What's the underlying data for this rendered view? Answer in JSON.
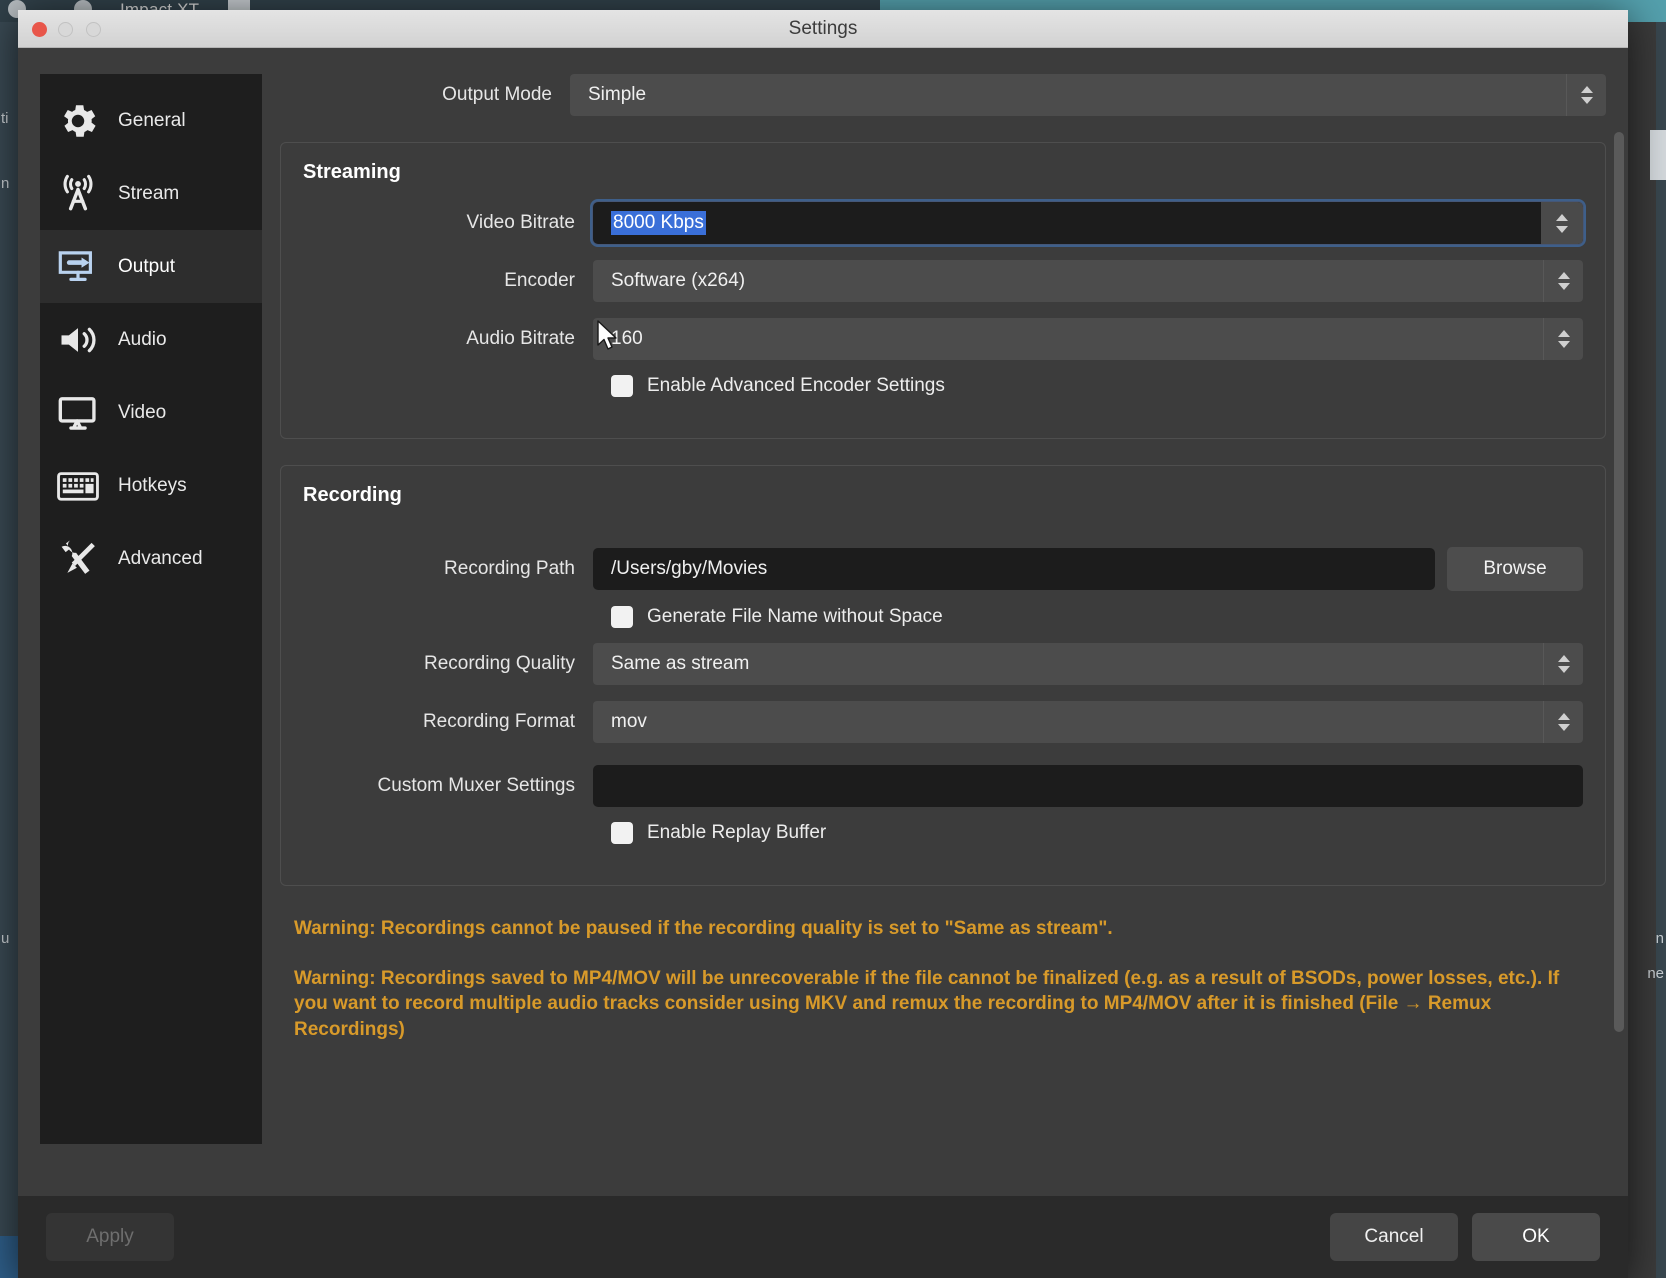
{
  "background_app": {
    "title": "Impact XT",
    "left_glyphs": [
      "ti",
      "n",
      "u"
    ],
    "right_glyphs": [
      "n",
      "ne"
    ]
  },
  "window": {
    "title": "Settings",
    "traffic_lights": [
      "close",
      "minimize",
      "maximize"
    ]
  },
  "sidebar": {
    "items": [
      {
        "label": "General",
        "icon": "gear-icon",
        "selected": false
      },
      {
        "label": "Stream",
        "icon": "broadcast-icon",
        "selected": false
      },
      {
        "label": "Output",
        "icon": "output-icon",
        "selected": true
      },
      {
        "label": "Audio",
        "icon": "speaker-icon",
        "selected": false
      },
      {
        "label": "Video",
        "icon": "monitor-icon",
        "selected": false
      },
      {
        "label": "Hotkeys",
        "icon": "keyboard-icon",
        "selected": false
      },
      {
        "label": "Advanced",
        "icon": "tools-icon",
        "selected": false
      }
    ]
  },
  "output_mode": {
    "label": "Output Mode",
    "value": "Simple"
  },
  "streaming": {
    "title": "Streaming",
    "video_bitrate": {
      "label": "Video Bitrate",
      "value": "8000 Kbps",
      "selected": true
    },
    "encoder": {
      "label": "Encoder",
      "value": "Software (x264)"
    },
    "audio_bitrate": {
      "label": "Audio Bitrate",
      "value": "160"
    },
    "advanced_encoder": {
      "label": "Enable Advanced Encoder Settings",
      "checked": false
    }
  },
  "recording": {
    "title": "Recording",
    "path": {
      "label": "Recording Path",
      "value": "/Users/gby/Movies",
      "browse_label": "Browse"
    },
    "generate_no_space": {
      "label": "Generate File Name without Space",
      "checked": false
    },
    "quality": {
      "label": "Recording Quality",
      "value": "Same as stream"
    },
    "format": {
      "label": "Recording Format",
      "value": "mov"
    },
    "muxer": {
      "label": "Custom Muxer Settings",
      "value": "",
      "placeholder": ""
    },
    "replay_buffer": {
      "label": "Enable Replay Buffer",
      "checked": false
    }
  },
  "warnings": [
    "Warning: Recordings cannot be paused if the recording quality is set to \"Same as stream\".",
    "Warning: Recordings saved to MP4/MOV will be unrecoverable if the file cannot be finalized (e.g. as a result of BSODs, power losses, etc.). If you want to record multiple audio tracks consider using MKV and remux the recording to MP4/MOV after it is finished (File → Remux Recordings)"
  ],
  "footer": {
    "apply_label": "Apply",
    "cancel_label": "Cancel",
    "ok_label": "OK"
  },
  "colors": {
    "warning": "#d89a2a",
    "selection": "#3a6fd8",
    "accent": "#9fc4e8",
    "dialog_bg": "#3c3c3c",
    "sidebar_bg": "#1e1e1e"
  }
}
